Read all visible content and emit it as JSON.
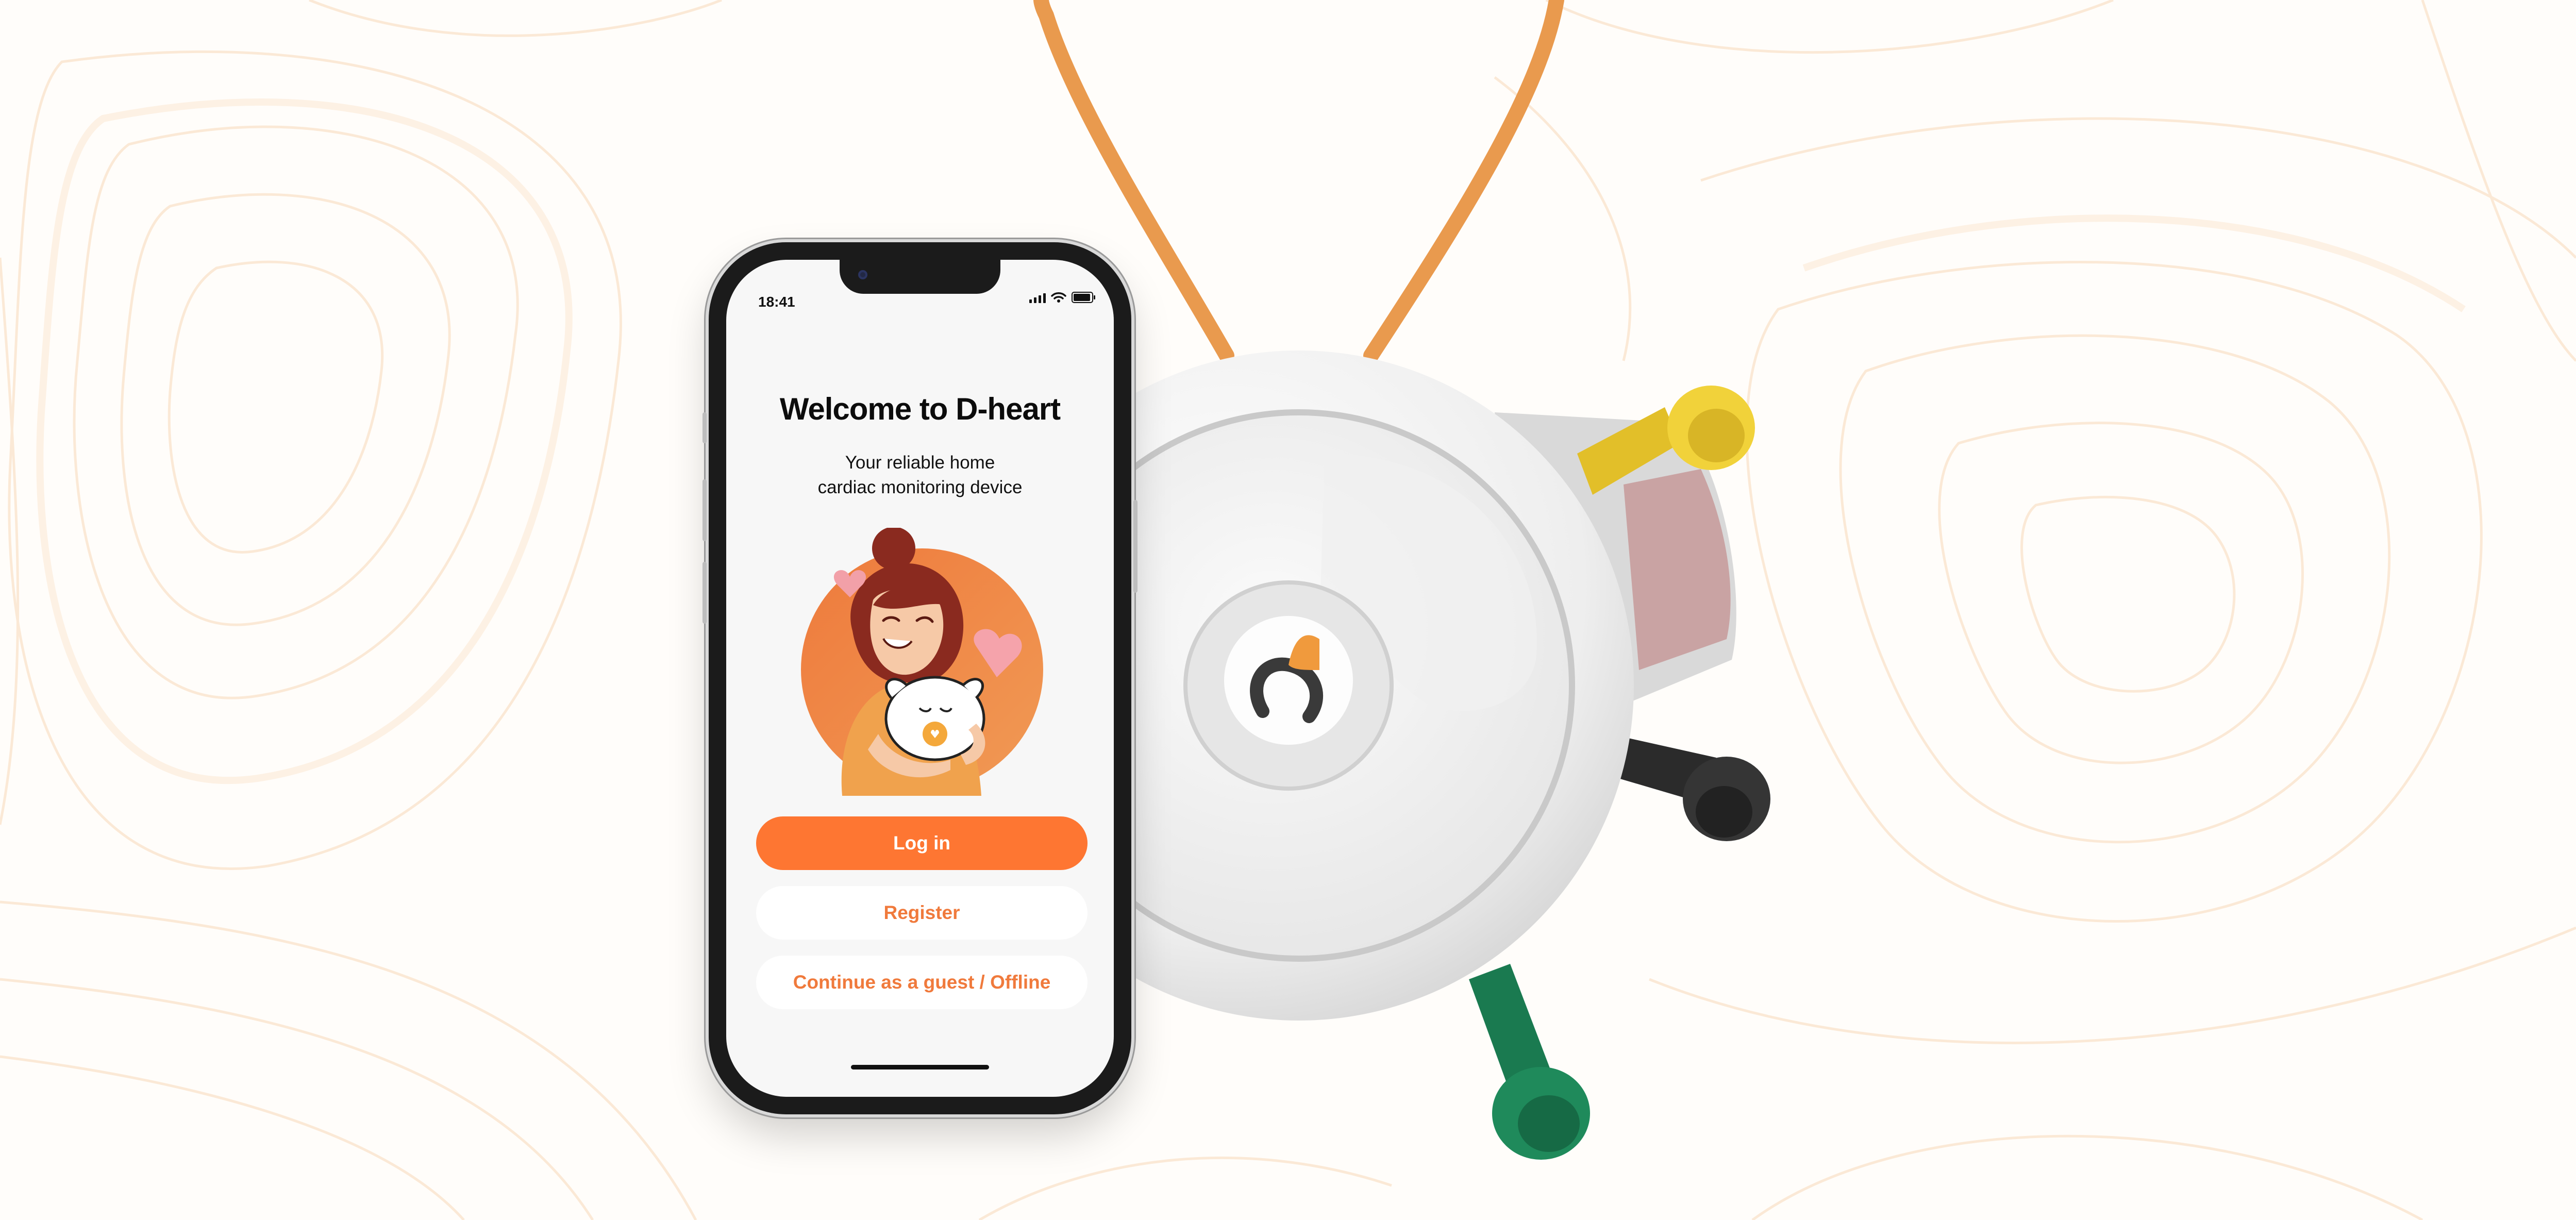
{
  "status_bar": {
    "time": "18:41",
    "icons": [
      "cellular-signal-icon",
      "wifi-icon",
      "battery-icon"
    ]
  },
  "welcome": {
    "title": "Welcome to D-heart",
    "subtitle_line1": "Your reliable home",
    "subtitle_line2": "cardiac monitoring device"
  },
  "actions": {
    "login_label": "Log in",
    "register_label": "Register",
    "guest_label": "Continue as a guest / Offline"
  },
  "colors": {
    "accent": "#fe7632",
    "accent_text": "#f07a3c",
    "screen_bg": "#f7f7f7",
    "page_bg": "#fffdfa",
    "contour": "#fbe9d6",
    "cable": "#e99a4e",
    "electrode_yellow": "#f1d23a",
    "electrode_black": "#2b2b2b",
    "electrode_green": "#1f8a5b"
  }
}
